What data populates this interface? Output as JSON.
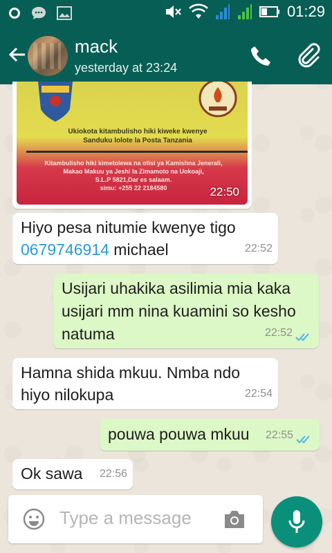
{
  "statusbar": {
    "time": "01:29"
  },
  "header": {
    "contact_name": "mack",
    "last_seen": "yesterday at 23:24"
  },
  "messages": {
    "image": {
      "caption_line1": "Ukiokota kitambulisho hiki kiweke kwenye",
      "caption_line2": "Sanduku lolote la Posta Tanzania",
      "body_line1": "Kitambulisho hiki kimetolewa na ofisi ya Kamishna Jenerali,",
      "body_line2": "Makao Makuu ya Jeshi la Zimamoto na Uokoaji,",
      "body_line3": "S.L.P 5821,Dar es salaam.",
      "body_line4": "simu: +255 22 2184580",
      "time": "22:50"
    },
    "m1": {
      "text_a": "Hiyo pesa nitumie kwenye tigo",
      "phone": "0679746914",
      "text_b": " michael",
      "time": "22:52"
    },
    "m2": {
      "line1": "Usijari uhakika asilimia mia kaka",
      "line2": "usijari mm nina kuamini so kesho",
      "line3": "natuma",
      "time": "22:52"
    },
    "m3": {
      "line1": "Hamna shida mkuu. Nmba ndo",
      "line2": "hiyo nilokupa",
      "time": "22:54"
    },
    "m4": {
      "text": "pouwa pouwa mkuu",
      "time": "22:55"
    },
    "m5": {
      "text": "Ok sawa",
      "time": "22:56"
    }
  },
  "composer": {
    "placeholder": "Type a message"
  },
  "colors": {
    "header": "#075e54",
    "outgoing": "#dcf8c6",
    "incoming": "#ffffff",
    "link": "#2a9bd6",
    "mic": "#0a8f7a",
    "read_ticks": "#4fb6ec"
  }
}
